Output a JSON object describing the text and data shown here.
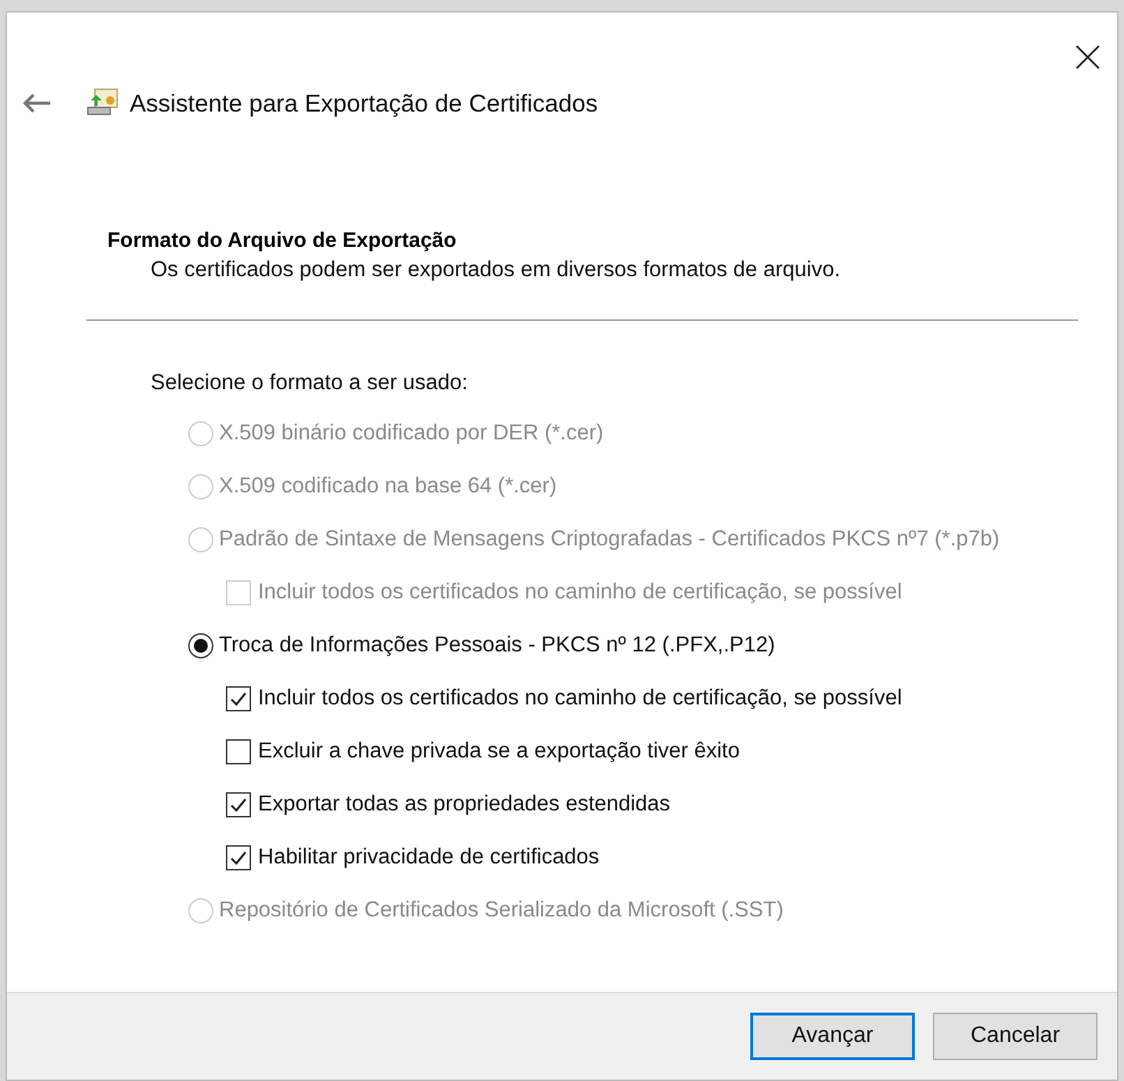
{
  "window": {
    "title": "Assistente para Exportação de Certificados"
  },
  "header": {
    "title": "Formato do Arquivo de Exportação",
    "subtitle": "Os certificados podem ser exportados em diversos formatos de arquivo."
  },
  "prompt": "Selecione o formato a ser usado:",
  "options": [
    {
      "label": "X.509 binário codificado por DER (*.cer)",
      "selected": false,
      "disabled": true
    },
    {
      "label": "X.509 codificado na base 64 (*.cer)",
      "selected": false,
      "disabled": true
    },
    {
      "label": "Padrão de Sintaxe de Mensagens Criptografadas - Certificados PKCS nº7 (*.p7b)",
      "selected": false,
      "disabled": true,
      "children": [
        {
          "label": "Incluir todos os certificados no caminho de certificação, se possível",
          "checked": false,
          "disabled": true
        }
      ]
    },
    {
      "label": "Troca de Informações Pessoais - PKCS nº 12 (.PFX,.P12)",
      "selected": true,
      "disabled": false,
      "children": [
        {
          "label": "Incluir todos os certificados no caminho de certificação, se possível",
          "checked": true,
          "disabled": false
        },
        {
          "label": "Excluir a chave privada se a exportação tiver êxito",
          "checked": false,
          "disabled": false
        },
        {
          "label": "Exportar todas as propriedades estendidas",
          "checked": true,
          "disabled": false
        },
        {
          "label": "Habilitar privacidade de certificados",
          "checked": true,
          "disabled": false
        }
      ]
    },
    {
      "label": "Repositório de Certificados Serializado da Microsoft (.SST)",
      "selected": false,
      "disabled": true
    }
  ],
  "buttons": [
    {
      "label": "Avançar",
      "default": true
    },
    {
      "label": "Cancelar",
      "default": false
    }
  ]
}
